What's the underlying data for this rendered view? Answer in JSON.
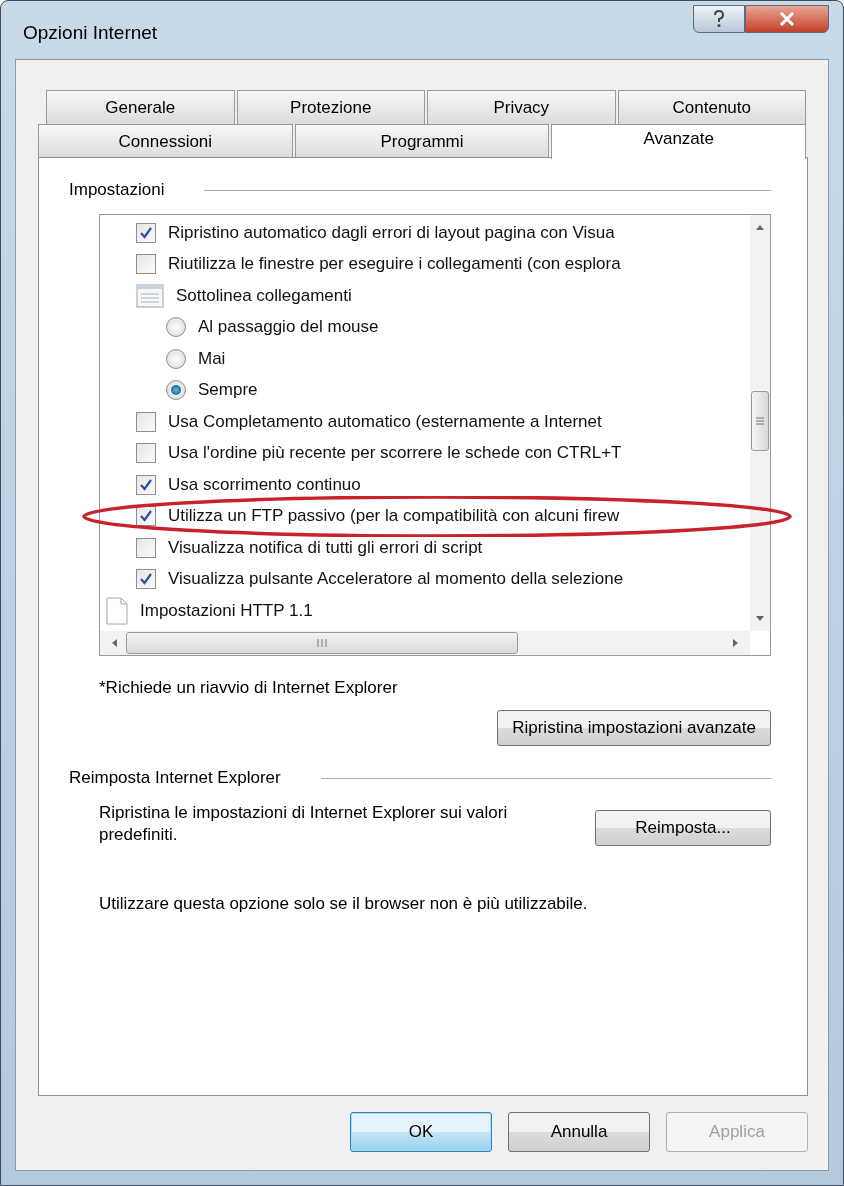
{
  "window": {
    "title": "Opzioni Internet"
  },
  "tab_rows": [
    {
      "tabs": [
        {
          "label": "Generale",
          "selected": false
        },
        {
          "label": "Protezione",
          "selected": false
        },
        {
          "label": "Privacy",
          "selected": false
        },
        {
          "label": "Contenuto",
          "selected": false
        }
      ]
    },
    {
      "tabs": [
        {
          "label": "Connessioni",
          "selected": false
        },
        {
          "label": "Programmi",
          "selected": false
        },
        {
          "label": "Avanzate",
          "selected": true
        }
      ]
    }
  ],
  "settings": {
    "heading": "Impostazioni",
    "items": [
      {
        "kind": "hidden-parent",
        "children": [
          {
            "kind": "checkbox",
            "label": "Ripristino automatico dagli errori di layout pagina con Visua",
            "checked": true
          },
          {
            "kind": "checkbox",
            "label": "Riutilizza le finestre per eseguire i collegamenti (con esplora",
            "checked": false
          },
          {
            "kind": "group",
            "label": "Sottolinea collegamenti",
            "children": [
              {
                "kind": "radio",
                "label": "Al passaggio del mouse",
                "selected": false
              },
              {
                "kind": "radio",
                "label": "Mai",
                "selected": false
              },
              {
                "kind": "radio",
                "label": "Sempre",
                "selected": true
              }
            ]
          },
          {
            "kind": "checkbox",
            "label": "Usa Completamento automatico (esternamente a Internet",
            "checked": false
          },
          {
            "kind": "checkbox",
            "label": "Usa l'ordine più recente per scorrere le schede con CTRL+T",
            "checked": false
          },
          {
            "kind": "checkbox",
            "label": "Usa scorrimento continuo",
            "checked": true
          },
          {
            "kind": "checkbox",
            "label": "Utilizza un FTP passivo (per la compatibilità con alcuni firew",
            "checked": true
          },
          {
            "kind": "checkbox",
            "label": "Visualizza notifica di tutti gli errori di script",
            "checked": false
          },
          {
            "kind": "checkbox",
            "label": "Visualizza pulsante Acceleratore al momento della selezione",
            "checked": true
          }
        ]
      },
      {
        "kind": "folder",
        "label": "Impostazioni HTTP 1.1"
      }
    ]
  },
  "restart_note": "*Richiede un riavvio di Internet Explorer",
  "restore_button": {
    "label": "Ripristina impostazioni avanzate"
  },
  "reset": {
    "heading": "Reimposta Internet Explorer",
    "description": "Ripristina le impostazioni di Internet Explorer sui valori predefiniti.",
    "button": {
      "label": "Reimposta..."
    },
    "note": "Utilizzare questa opzione solo se il browser non è più utilizzabile."
  },
  "buttons": [
    {
      "label": "OK",
      "default": true,
      "disabled": false
    },
    {
      "label": "Annulla",
      "default": false,
      "disabled": false
    },
    {
      "label": "Applica",
      "default": false,
      "disabled": true
    }
  ]
}
